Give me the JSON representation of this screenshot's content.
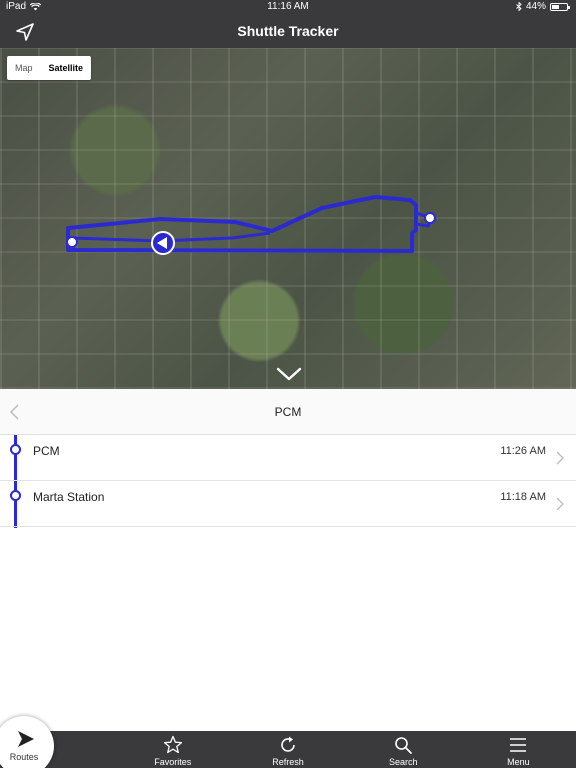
{
  "status_bar": {
    "device": "iPad",
    "time": "11:16 AM",
    "battery": "44%",
    "battery_level": 0.44
  },
  "nav": {
    "title": "Shuttle Tracker",
    "location_icon": "location-arrow-icon"
  },
  "map": {
    "toggle": {
      "map_label": "Map",
      "satellite_label": "Satellite",
      "selected": "Satellite"
    },
    "route_color": "#2a2ad0"
  },
  "route": {
    "title": "PCM"
  },
  "stops": [
    {
      "name": "PCM",
      "time": "11:26 AM"
    },
    {
      "name": "Marta Station",
      "time": "11:18 AM"
    }
  ],
  "tabs": [
    {
      "label": "Routes",
      "icon": "play-icon",
      "active": true
    },
    {
      "label": "Favorites",
      "icon": "star-icon"
    },
    {
      "label": "Refresh",
      "icon": "refresh-icon"
    },
    {
      "label": "Search",
      "icon": "search-icon"
    },
    {
      "label": "Menu",
      "icon": "menu-icon"
    }
  ],
  "colors": {
    "bar_background": "#3a3a3c",
    "route_blue": "#2a2ad0"
  }
}
